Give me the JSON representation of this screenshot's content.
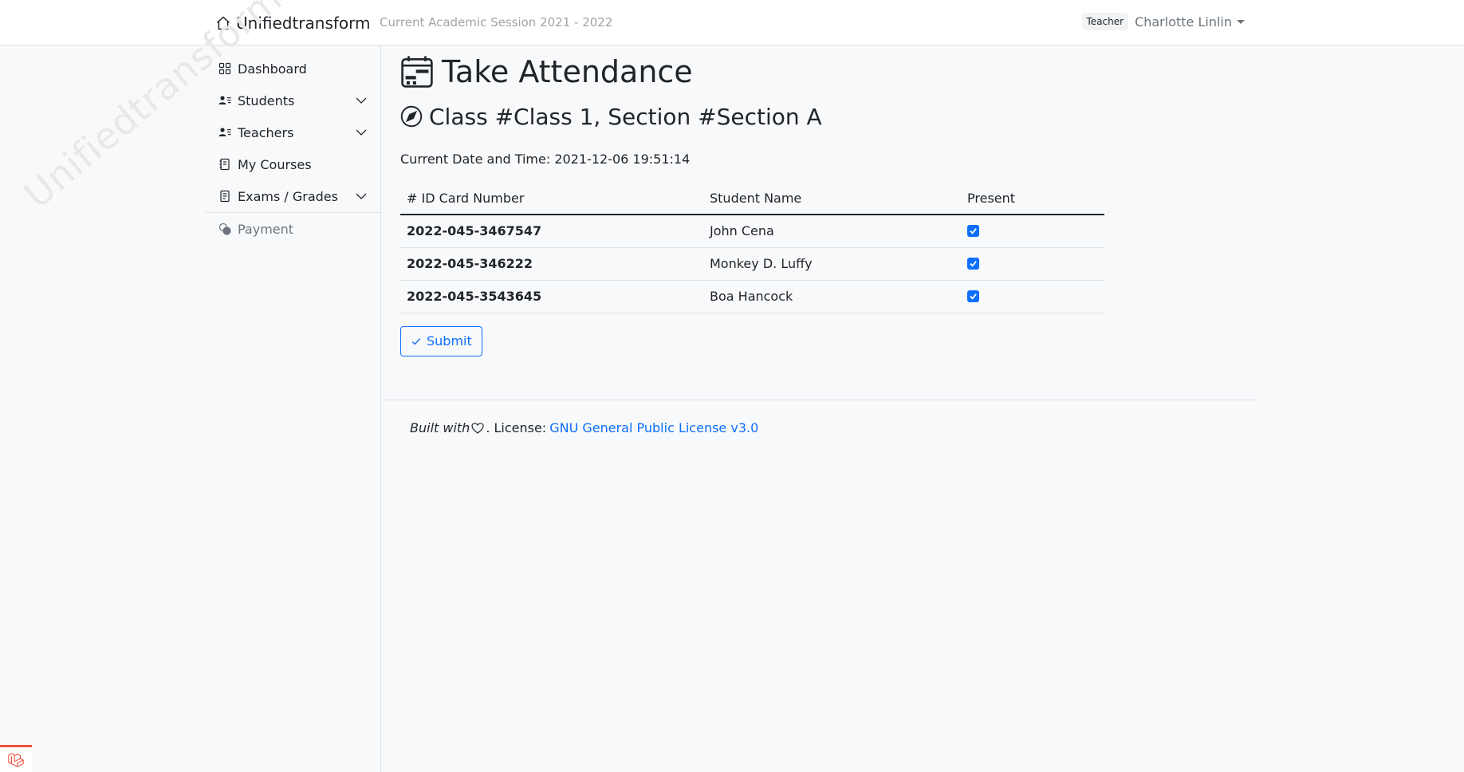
{
  "navbar": {
    "brand": "Unifiedtransform",
    "session": "Current Academic Session 2021 - 2022",
    "role_badge": "Teacher",
    "user_name": "Charlotte Linlin"
  },
  "watermark": "Unifiedtransform",
  "sidebar": {
    "items": [
      {
        "label": "Dashboard",
        "icon": "grid-icon"
      },
      {
        "label": "Students",
        "icon": "person-lines-icon"
      },
      {
        "label": "Teachers",
        "icon": "person-lines-icon"
      },
      {
        "label": "My Courses",
        "icon": "journal-icon"
      },
      {
        "label": "Exams / Grades",
        "icon": "file-text-icon"
      },
      {
        "label": "Payment",
        "icon": "coins-icon"
      }
    ]
  },
  "main": {
    "title": "Take Attendance",
    "class_title": "Class #Class 1, Section #Section A",
    "datetime": "Current Date and Time: 2021-12-06 19:51:14",
    "table": {
      "headers": [
        "# ID Card Number",
        "Student Name",
        "Present"
      ],
      "rows": [
        {
          "id": "2022-045-3467547",
          "name": "John Cena",
          "present": true
        },
        {
          "id": "2022-045-346222",
          "name": "Monkey D. Luffy",
          "present": true
        },
        {
          "id": "2022-045-3543645",
          "name": "Boa Hancock",
          "present": true
        }
      ]
    },
    "submit_label": "Submit"
  },
  "footer": {
    "built_with": "Built with",
    "license_prefix": ". License:",
    "license_link": "GNU General Public License v3.0"
  },
  "colors": {
    "primary": "#0d6efd",
    "laravel": "#f05340"
  }
}
